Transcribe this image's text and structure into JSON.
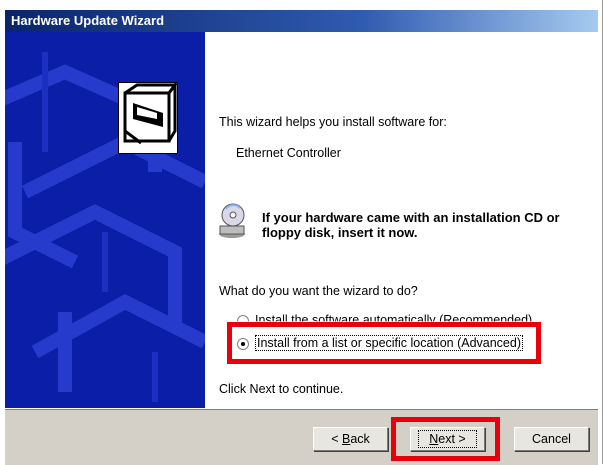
{
  "window": {
    "title": "Hardware Update Wizard"
  },
  "main": {
    "intro": "This wizard helps you install software for:",
    "device": "Ethernet Controller",
    "cd_prompt": "If your hardware came with an installation CD or floppy disk, insert it now.",
    "question": "What do you want the wizard to do?",
    "options": [
      {
        "label": "Install the software automatically (Recommended)",
        "selected": false
      },
      {
        "label": "Install from a list or specific location (Advanced)",
        "selected": true
      }
    ],
    "continue_hint": "Click Next to continue."
  },
  "footer": {
    "back_prefix": "< ",
    "back_hotkey": "B",
    "back_rest": "ack",
    "next_hotkey": "N",
    "next_rest": "ext >",
    "cancel_label": "Cancel"
  },
  "colors": {
    "highlight": "#e8000a",
    "banner": "#0b1ea8",
    "titlebar": "#0a246a"
  }
}
